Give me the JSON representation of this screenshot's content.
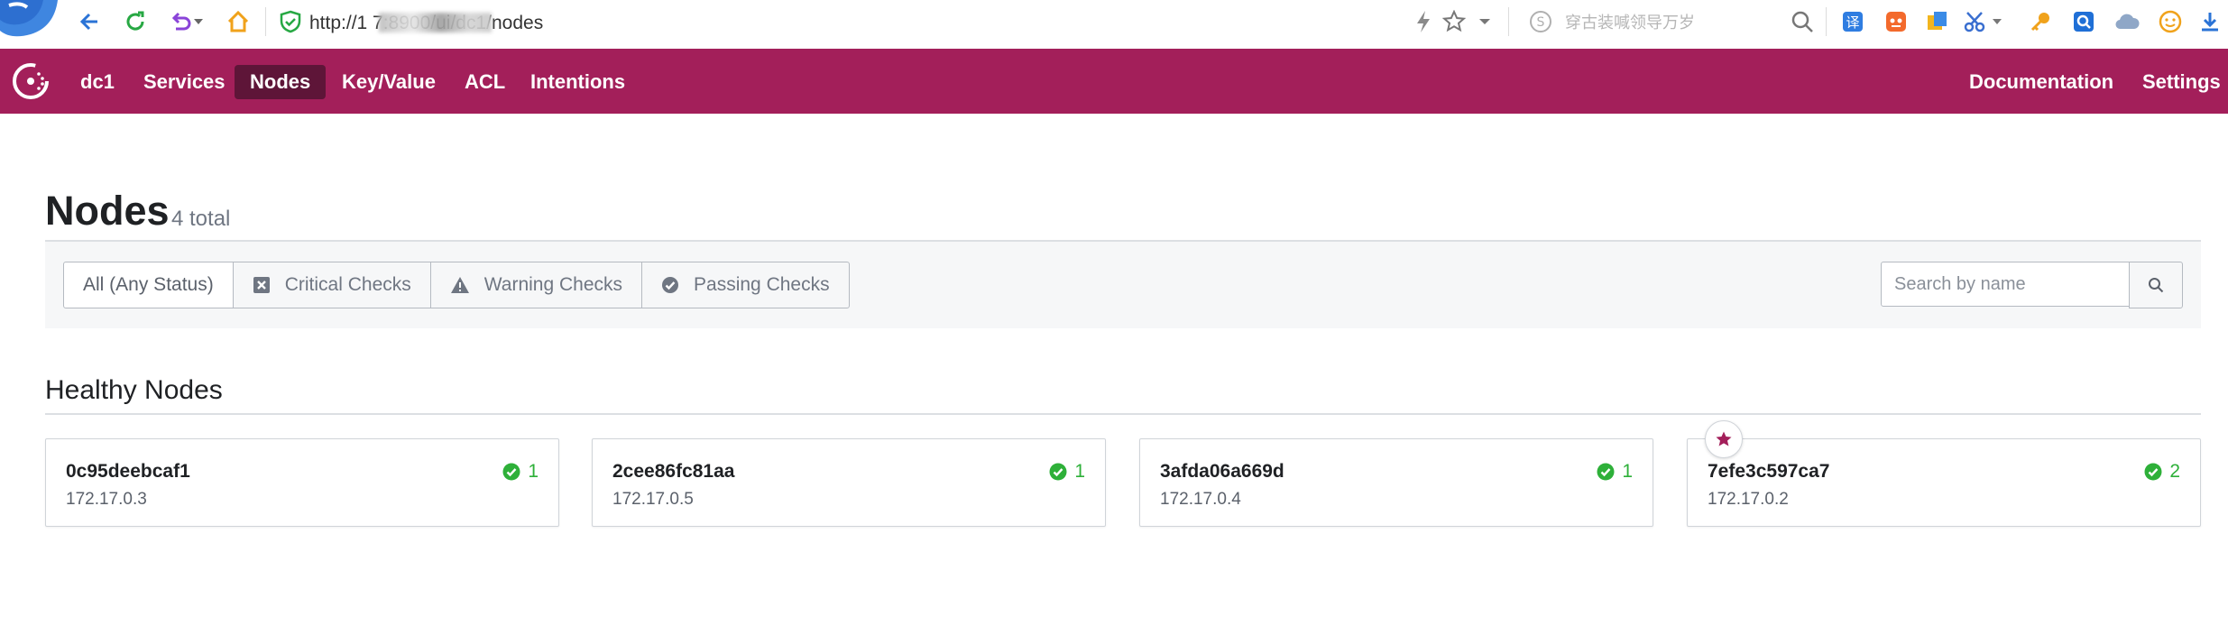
{
  "browser": {
    "url": "http://1                  7:8900/ui/dc1/nodes",
    "search_engine_text": "穿古装喊领导万岁"
  },
  "topnav": {
    "datacenter": "dc1",
    "items": [
      {
        "label": "Services"
      },
      {
        "label": "Nodes"
      },
      {
        "label": "Key/Value"
      },
      {
        "label": "ACL"
      },
      {
        "label": "Intentions"
      }
    ],
    "active": "Nodes",
    "documentation": "Documentation",
    "settings": "Settings"
  },
  "page": {
    "title": "Nodes",
    "count": "4 total"
  },
  "filters": {
    "items": [
      {
        "label": "All (Any Status)",
        "icon": "none"
      },
      {
        "label": "Critical Checks",
        "icon": "critical-icon"
      },
      {
        "label": "Warning Checks",
        "icon": "warning-icon"
      },
      {
        "label": "Passing Checks",
        "icon": "passing-icon"
      }
    ],
    "selected": "All (Any Status)"
  },
  "search": {
    "placeholder": "Search by name"
  },
  "section": {
    "title": "Healthy Nodes"
  },
  "nodes": [
    {
      "name": "0c95deebcaf1",
      "address": "172.17.0.3",
      "passing": "1",
      "leader": false
    },
    {
      "name": "2cee86fc81aa",
      "address": "172.17.0.5",
      "passing": "1",
      "leader": false
    },
    {
      "name": "3afda06a669d",
      "address": "172.17.0.4",
      "passing": "1",
      "leader": false
    },
    {
      "name": "7efe3c597ca7",
      "address": "172.17.0.2",
      "passing": "2",
      "leader": true
    }
  ],
  "colors": {
    "brand": "#a31f5a",
    "nav_active": "#5e1538",
    "passing": "#2eb039"
  }
}
